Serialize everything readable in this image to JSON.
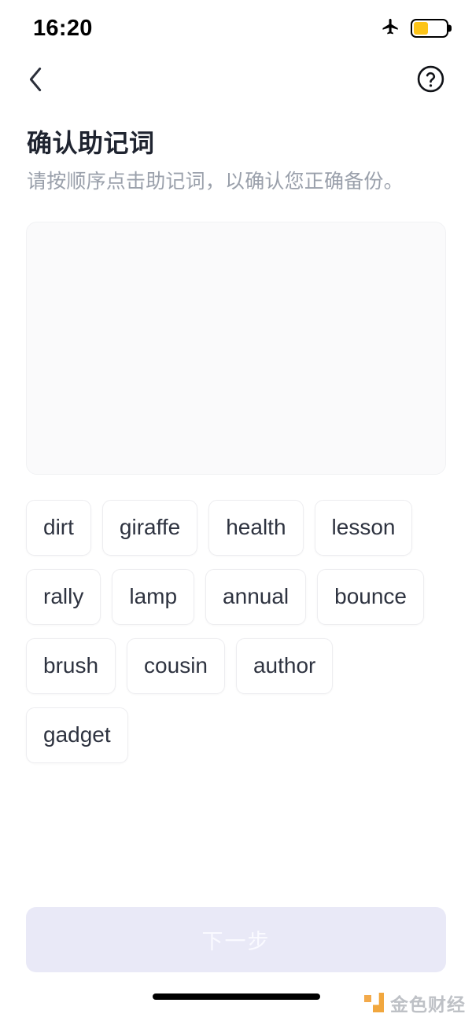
{
  "status_bar": {
    "time": "16:20",
    "airplane_icon": "airplane-icon",
    "battery_icon": "battery-icon",
    "battery_level_percent": 45,
    "battery_color": "#fcc419"
  },
  "nav": {
    "back_icon": "chevron-left-icon",
    "help_icon": "question-circle-icon"
  },
  "header": {
    "title": "确认助记词",
    "subtitle": "请按顺序点击助记词，以确认您正确备份。"
  },
  "answer_area": {
    "selected_words": [],
    "background_color": "#fafafb"
  },
  "word_pool": {
    "words": [
      "dirt",
      "giraffe",
      "health",
      "lesson",
      "rally",
      "lamp",
      "annual",
      "bounce",
      "brush",
      "cousin",
      "author",
      "gadget"
    ]
  },
  "footer": {
    "next_label": "下一步",
    "next_disabled": true,
    "button_color": "#e9e9f7"
  },
  "watermark": {
    "text": "金色财经",
    "logo_color": "#f0a02e"
  }
}
